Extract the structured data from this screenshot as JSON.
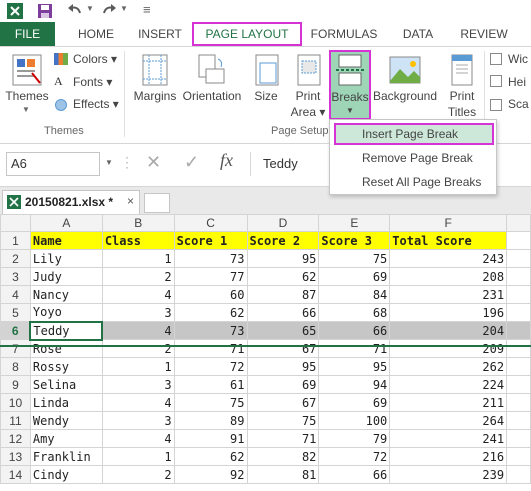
{
  "qat": {
    "icons": [
      "excel-icon",
      "save-icon",
      "undo-icon",
      "redo-icon"
    ]
  },
  "tabs": [
    {
      "label": "FILE"
    },
    {
      "label": "HOME"
    },
    {
      "label": "INSERT"
    },
    {
      "label": "PAGE LAYOUT"
    },
    {
      "label": "FORMULAS"
    },
    {
      "label": "DATA"
    },
    {
      "label": "REVIEW"
    }
  ],
  "ribbon": {
    "themes": "Themes",
    "colors": "Colors",
    "fonts": "Fonts",
    "effects": "Effects",
    "themes_group": "Themes",
    "margins": "Margins",
    "orientation": "Orientation",
    "size": "Size",
    "print_area_1": "Print",
    "print_area_2": "Area",
    "breaks": "Breaks",
    "background": "Background",
    "print_titles_1": "Print",
    "print_titles_2": "Titles",
    "page_setup_group": "Page Setup",
    "wid": "Wic",
    "hei": "Hei",
    "sca": "Sca"
  },
  "dropdown": {
    "items": [
      "Insert Page Break",
      "Remove Page Break",
      "Reset All Page Breaks"
    ]
  },
  "formula_bar": {
    "name_box": "A6",
    "fx": "fx",
    "content": "Teddy"
  },
  "sheet_tab": {
    "name": "20150821.xlsx *"
  },
  "columns": [
    "A",
    "B",
    "C",
    "D",
    "E",
    "F"
  ],
  "rows": [
    {
      "n": "1",
      "cells": [
        "Name",
        "Class",
        "Score 1",
        "Score 2",
        "Score 3",
        "Total Score"
      ]
    },
    {
      "n": "2",
      "cells": [
        "Lily",
        "1",
        "73",
        "95",
        "75",
        "243"
      ]
    },
    {
      "n": "3",
      "cells": [
        "Judy",
        "2",
        "77",
        "62",
        "69",
        "208"
      ]
    },
    {
      "n": "4",
      "cells": [
        "Nancy",
        "4",
        "60",
        "87",
        "84",
        "231"
      ]
    },
    {
      "n": "5",
      "cells": [
        "Yoyo",
        "3",
        "62",
        "66",
        "68",
        "196"
      ]
    },
    {
      "n": "6",
      "cells": [
        "Teddy",
        "4",
        "73",
        "65",
        "66",
        "204"
      ]
    },
    {
      "n": "7",
      "cells": [
        "Rose",
        "2",
        "71",
        "67",
        "71",
        "209"
      ]
    },
    {
      "n": "8",
      "cells": [
        "Rossy",
        "1",
        "72",
        "95",
        "95",
        "262"
      ]
    },
    {
      "n": "9",
      "cells": [
        "Selina",
        "3",
        "61",
        "69",
        "94",
        "224"
      ]
    },
    {
      "n": "10",
      "cells": [
        "Linda",
        "4",
        "75",
        "67",
        "69",
        "211"
      ]
    },
    {
      "n": "11",
      "cells": [
        "Wendy",
        "3",
        "89",
        "75",
        "100",
        "264"
      ]
    },
    {
      "n": "12",
      "cells": [
        "Amy",
        "4",
        "91",
        "71",
        "79",
        "241"
      ]
    },
    {
      "n": "13",
      "cells": [
        "Franklin",
        "1",
        "62",
        "82",
        "72",
        "216"
      ]
    },
    {
      "n": "14",
      "cells": [
        "Cindy",
        "2",
        "92",
        "81",
        "66",
        "239"
      ]
    }
  ]
}
